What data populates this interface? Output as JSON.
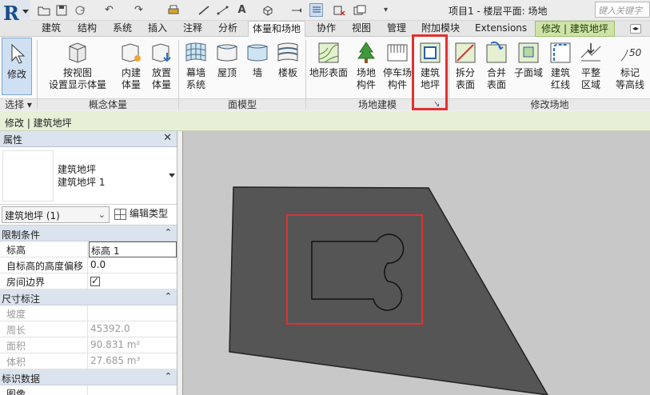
{
  "title_bar": {
    "project_title": "项目1 - 楼层平面: 场地",
    "search_placeholder": "键入关键字"
  },
  "tabs": [
    {
      "label": "建筑"
    },
    {
      "label": "结构"
    },
    {
      "label": "系统"
    },
    {
      "label": "插入"
    },
    {
      "label": "注释"
    },
    {
      "label": "分析"
    },
    {
      "label": "体量和场地",
      "active": true
    },
    {
      "label": "协作"
    },
    {
      "label": "视图"
    },
    {
      "label": "管理"
    },
    {
      "label": "附加模块"
    },
    {
      "label": "Extensions"
    },
    {
      "label": "修改 | 建筑地坪",
      "contextual": true
    }
  ],
  "ribbon": {
    "select": {
      "modify": "修改",
      "panel": "选择"
    },
    "conceptual_mass": {
      "show_mass": "按视图\n设置显示体量",
      "in_place_mass": "内建\n体量",
      "place_mass": "放置\n体量",
      "panel": "概念体量"
    },
    "model_by_face": {
      "curtain_system": "幕墙\n系统",
      "roof": "屋顶",
      "wall": "墙",
      "floor": "楼板",
      "panel": "面模型"
    },
    "site_modeling": {
      "toposurface": "地形表面",
      "site_component": "场地\n构件",
      "parking_component": "停车场\n构件",
      "building_pad": "建筑\n地坪",
      "panel": "场地建模"
    },
    "modify_site": {
      "split_surface": "拆分\n表面",
      "merge_surfaces": "合并\n表面",
      "subregion": "子面域",
      "property_line": "建筑\n红线",
      "graded_region": "平整\n区域",
      "label_contours": "标记\n等高线",
      "label_value": "50",
      "panel": "修改场地"
    }
  },
  "options_bar": {
    "text": "修改 | 建筑地坪"
  },
  "properties": {
    "header": "属性",
    "type_line1": "建筑地坪",
    "type_line2": "建筑地坪 1",
    "instance_filter": "建筑地坪 (1)",
    "edit_type": "编辑类型",
    "sections": {
      "constraints": "限制条件",
      "dimensions": "尺寸标注",
      "identity": "标识数据"
    },
    "constraints_rows": [
      {
        "key": "标高",
        "value": "标高 1"
      },
      {
        "key": "自标高的高度偏移",
        "value": "0.0"
      },
      {
        "key": "房间边界",
        "value": ""
      }
    ],
    "dimension_rows": [
      {
        "key": "坡度",
        "value": ""
      },
      {
        "key": "周长",
        "value": "45392.0"
      },
      {
        "key": "面积",
        "value": "90.831 m²"
      },
      {
        "key": "体积",
        "value": "27.685 m³"
      }
    ],
    "identity_rows": [
      {
        "key": "图像",
        "value": ""
      }
    ]
  },
  "colors": {
    "highlight": "#e03131",
    "site_fill": "#555555",
    "canvas_bg": "#c8c8c8",
    "contextual_tab": "#cfe3a9"
  }
}
